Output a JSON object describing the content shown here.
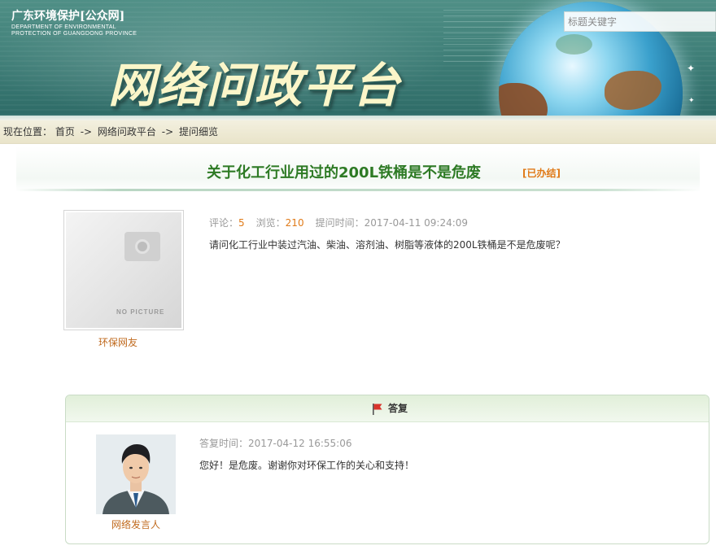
{
  "header": {
    "logo_cn": "广东环境保护[公众网]",
    "logo_en_line1": "DEPARTMENT OF ENVIRONMENTAL",
    "logo_en_line2": "PROTECTION OF GUANGDONG PROVINCE",
    "banner_title": "网络问政平台",
    "search_placeholder": "标题关键字"
  },
  "breadcrumb": {
    "label": "现在位置：",
    "items": [
      "首页",
      "网络问政平台",
      "提问细览"
    ],
    "separator": "->"
  },
  "question": {
    "title": "关于化工行业用过的200L铁桶是不是危废",
    "status": "[已办结]",
    "asker": "环保网友",
    "photo_placeholder_text": "NO PICTURE",
    "comments_label": "评论：",
    "comments_count": "5",
    "views_label": "浏览：",
    "views_count": "210",
    "time_label": "提问时间：",
    "time_value": "2017-04-11 09:24:09",
    "body": "请问化工行业中装过汽油、柴油、溶剂油、树脂等液体的200L铁桶是不是危废呢？"
  },
  "reply": {
    "header_title": "答复",
    "responder": "网络发言人",
    "time_label": "答复时间：",
    "time_value": "2017-04-12 16:55:06",
    "body": "您好！是危废。谢谢你对环保工作的关心和支持！"
  },
  "colors": {
    "title_green": "#2d7a24",
    "status_orange": "#e07a18",
    "name_orange": "#c06a1e",
    "banner_teal": "#3f7f78"
  },
  "icons": {
    "header_icon": "globe-icon",
    "reply_icon": "flag-icon",
    "placeholder_icon": "camera-icon"
  }
}
